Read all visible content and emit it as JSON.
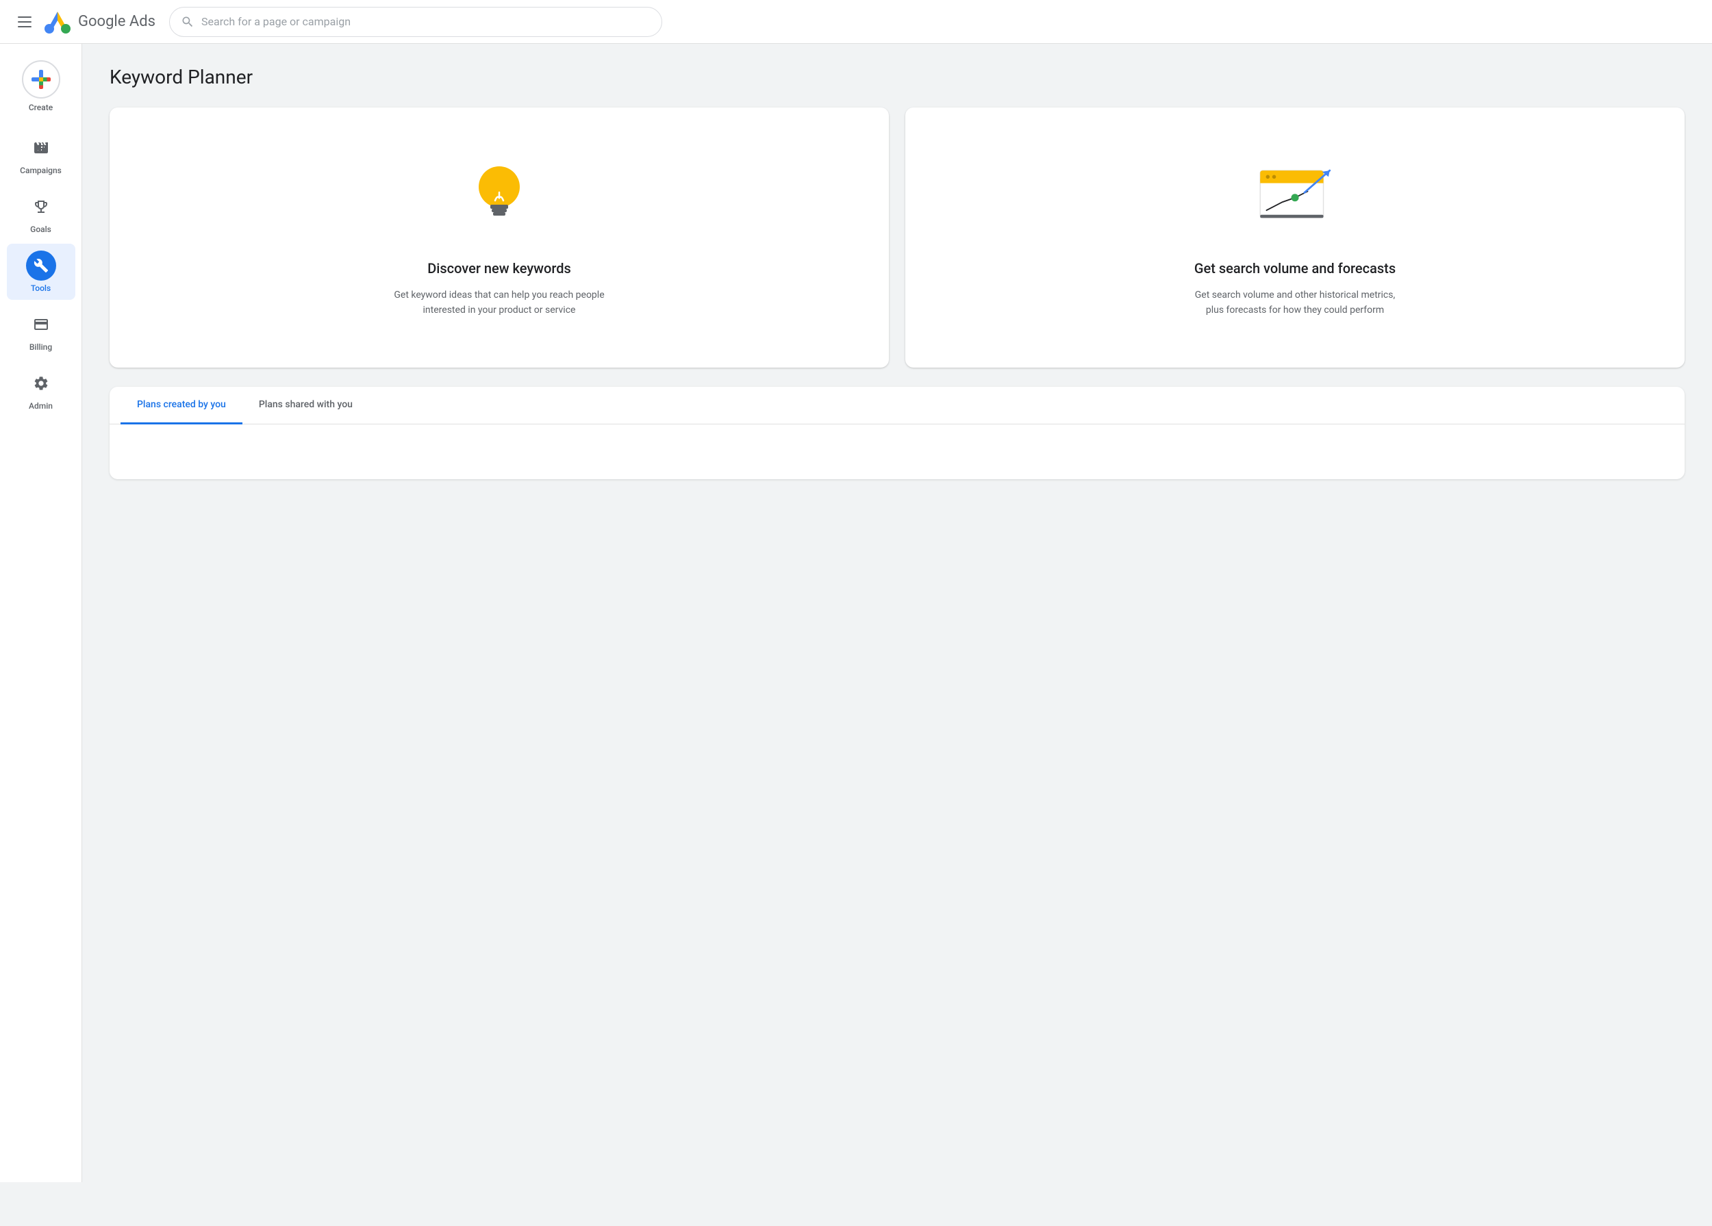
{
  "header": {
    "title": "Google Ads",
    "search_placeholder": "Search for a page or campaign"
  },
  "sidebar": {
    "create_label": "Create",
    "items": [
      {
        "id": "campaigns",
        "label": "Campaigns",
        "active": false
      },
      {
        "id": "goals",
        "label": "Goals",
        "active": false
      },
      {
        "id": "tools",
        "label": "Tools",
        "active": true
      },
      {
        "id": "billing",
        "label": "Billing",
        "active": false
      },
      {
        "id": "admin",
        "label": "Admin",
        "active": false
      }
    ]
  },
  "main": {
    "page_title": "Keyword Planner",
    "cards": [
      {
        "id": "discover",
        "title": "Discover new keywords",
        "description": "Get keyword ideas that can help you reach people interested in your product or service"
      },
      {
        "id": "forecasts",
        "title": "Get search volume and forecasts",
        "description": "Get search volume and other historical metrics, plus forecasts for how they could perform"
      }
    ],
    "tabs": [
      {
        "id": "created-by-you",
        "label": "Plans created by you",
        "active": true
      },
      {
        "id": "shared-with-you",
        "label": "Plans shared with you",
        "active": false
      }
    ]
  }
}
